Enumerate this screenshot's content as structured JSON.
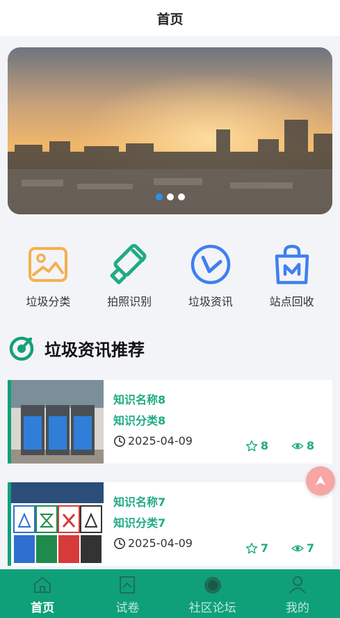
{
  "header": {
    "title": "首页"
  },
  "banner": {
    "dots": 3,
    "active_dot": 0
  },
  "quick_actions": [
    {
      "label": "垃圾分类",
      "icon": "image-frame-icon",
      "color": "#f5b04f"
    },
    {
      "label": "拍照识别",
      "icon": "paint-roller-icon",
      "color": "#1fab84"
    },
    {
      "label": "垃圾资讯",
      "icon": "news-circle-icon",
      "color": "#3f7ff0"
    },
    {
      "label": "站点回收",
      "icon": "shopping-bag-icon",
      "color": "#3f7ff0"
    }
  ],
  "section": {
    "title": "垃圾资讯推荐"
  },
  "articles": [
    {
      "name": "知识名称8",
      "category": "知识分类8",
      "date": "2025-04-09",
      "likes": "8",
      "views": "8"
    },
    {
      "name": "知识名称7",
      "category": "知识分类7",
      "date": "2025-04-09",
      "likes": "7",
      "views": "7"
    }
  ],
  "tabbar": {
    "items": [
      {
        "label": "首页",
        "icon": "home-icon"
      },
      {
        "label": "试卷",
        "icon": "exam-icon"
      },
      {
        "label": "社区论坛",
        "icon": "forum-icon"
      },
      {
        "label": "我的",
        "icon": "user-icon"
      }
    ],
    "active": 0
  },
  "colors": {
    "accent": "#0fa079",
    "text_green": "#1fab84",
    "fab": "#f7a5a5"
  }
}
